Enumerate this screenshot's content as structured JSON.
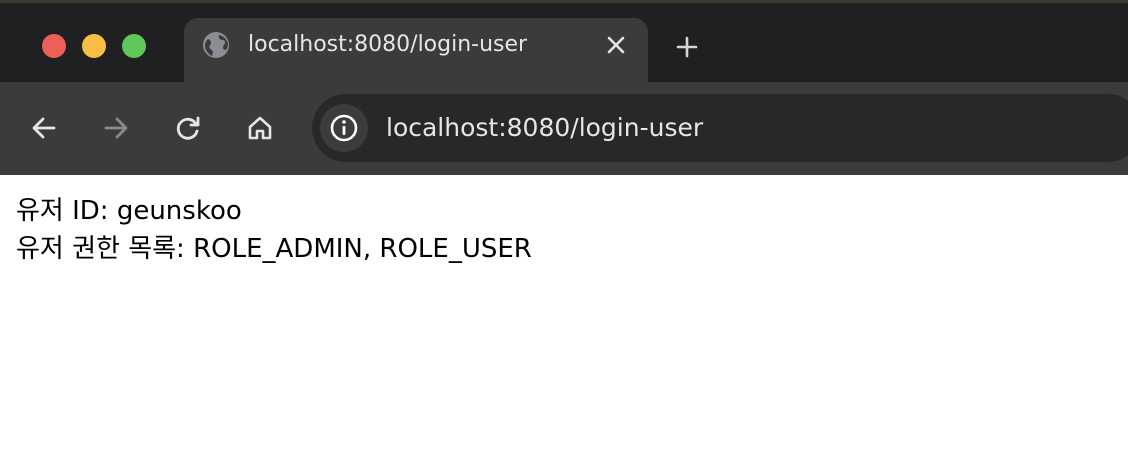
{
  "browser": {
    "tab": {
      "title": "localhost:8080/login-user",
      "icon": "globe-icon"
    },
    "address_bar": {
      "url": "localhost:8080/login-user",
      "icon": "info-icon"
    },
    "controls": {
      "back_icon": "arrow-left-icon",
      "forward_icon": "arrow-right-icon",
      "reload_icon": "reload-icon",
      "home_icon": "home-icon",
      "new_tab_icon": "plus-icon",
      "close_tab_icon": "close-icon"
    },
    "colors": {
      "titlebar": "#1f2021",
      "toolbar": "#3b3b3b",
      "omnibox": "#282828",
      "traffic_red": "#ee5f58",
      "traffic_yellow": "#f8bd44",
      "traffic_green": "#5fc758"
    }
  },
  "page": {
    "lines": [
      "유저 ID: geunskoo",
      "유저 권한 목록: ROLE_ADMIN, ROLE_USER"
    ]
  }
}
